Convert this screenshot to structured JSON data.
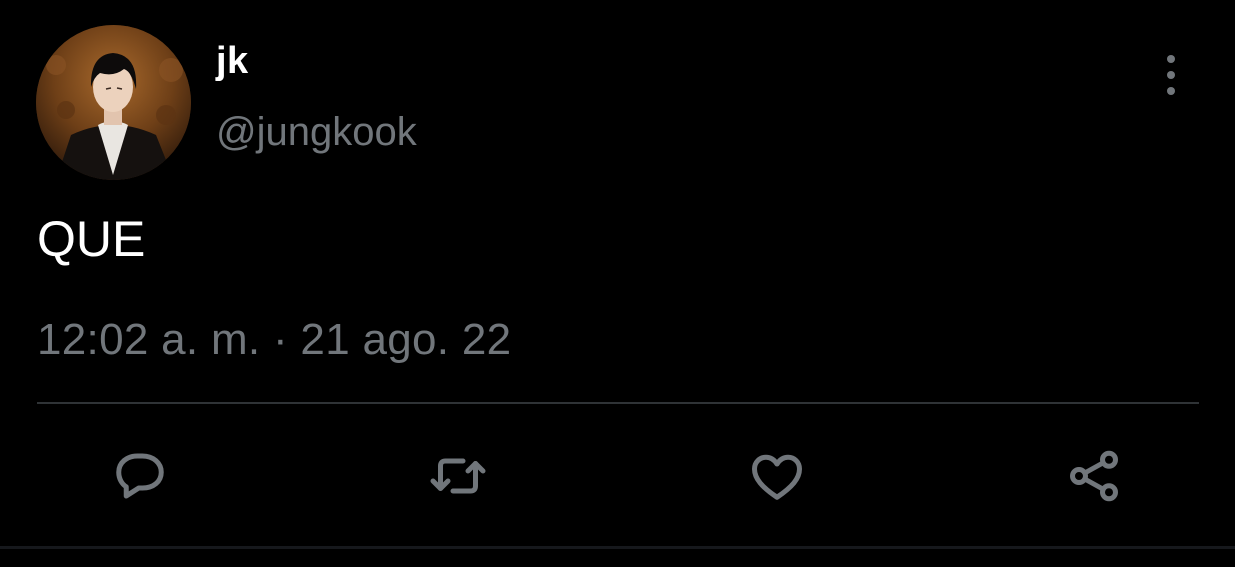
{
  "tweet": {
    "author": {
      "display_name": "jk",
      "handle": "@jungkook"
    },
    "text": "QUE",
    "timestamp": "12:02 a. m. · 21 ago. 22"
  },
  "actions": [
    {
      "name": "reply",
      "icon": "reply-icon"
    },
    {
      "name": "retweet",
      "icon": "retweet-icon"
    },
    {
      "name": "like",
      "icon": "heart-icon"
    },
    {
      "name": "share",
      "icon": "share-icon"
    }
  ],
  "icons": {
    "more": "more-vertical-icon"
  },
  "colors": {
    "background": "#000000",
    "primary_text": "#ffffff",
    "secondary_text": "#71767b",
    "divider": "#2f3336"
  }
}
